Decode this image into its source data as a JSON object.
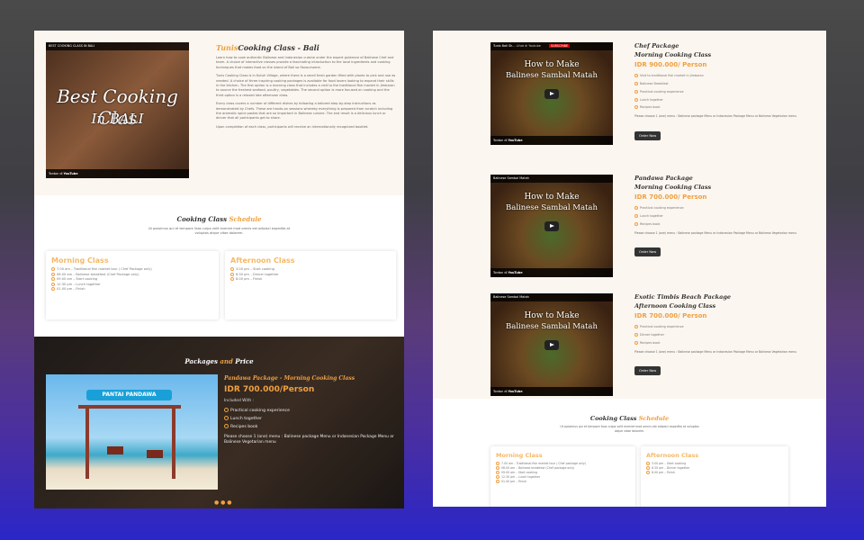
{
  "left": {
    "video": {
      "title": "BEST COOKING CLASS IN BALI",
      "overlay_line1": "Best Cooking Clas",
      "overlay_line2": "In BALI",
      "watch_on": "Tonton di",
      "yt": "YouTube"
    },
    "intro_title_prefix": "Tunis",
    "intro_title_rest": "Cooking Class - Bali",
    "intro_p1": "Learn how to cook authentic Balinese and Indonesian cuisine under the expert guidance of Balinese Chef and team. A choice of interactive classes provide a fascinating introduction to the local ingredients and cooking techniques that makes food on the island of Bali so flavoursome.",
    "intro_p2": "Tunis Cooking Class is in Kutuh Village, where there is a small fresh garden filled with plants to pick and use as needed. A choice of three inspiring cooking packages is available for food lovers looking to expand their skills in the kitchen. The first option is a morning class that includes a visit to the traditional fish market in Jimbaran to source the freshest seafood, poultry, vegetables. The second option is more focused on cooking and the third option is a relaxed late afternoon class.",
    "intro_p3": "Every class covers a number of different dishes by following a tailored step-by-step instructions as demonstrated by Chefs. These are hands-on sessions whereby everything is prepared from scratch including the aromatic spice pastes that are so important in Balinese cuisine. The end result is a delicious lunch or dinner that all participants get to share.",
    "intro_p4": "Upon completion of each class, participants will receive an internationally recognized booklet.",
    "schedule": {
      "title_a": "Cooking Class ",
      "title_b": "Schedule",
      "sub": "Ut possimus qui et tempore lisas culpa velit eveniet mod omnis est adipisci expedita at voluptas atque vitae dolorem.",
      "morning": {
        "title": "Morning Class",
        "items": [
          "7.00 am – Traditional fish market tour ( Chef Package only)",
          "08.00 am – Balinese breakfast (Chef Package only)",
          "09.00 am – Start cooking",
          "12.30 pm – Lunch together",
          "01.00 pm – Finish"
        ]
      },
      "afternoon": {
        "title": "Afternoon Class",
        "items": [
          "3.00 pm – Start cooking",
          "6.30 pm – Dinner together",
          "8.00 pm – Finish"
        ]
      }
    },
    "packages": {
      "title_a": "Packages ",
      "title_b": "and",
      "title_c": " Price",
      "image_sign": "PANTAI PANDAWA",
      "pkg_title": "Pandawa Package - Morning Cooking Class",
      "price": "IDR 700.000/Person",
      "included": "Included With :",
      "items": [
        "Practical cooking experience",
        "Lunch together",
        "Recipes book"
      ],
      "note": "Please choose 1 (one) menu : Balinese package Menu or Indonesian Package Menu or Balinese Vegetarian menu"
    }
  },
  "right": {
    "packages": [
      {
        "video_title": "Tunis Bali Sh...",
        "video_sub": "Lihat di Youtube",
        "subscribe": "SUBSCRIBE",
        "big1": "How to Make",
        "big2": "Balinese Sambal Matah",
        "name": "Chef Package",
        "session": "Morning Cooking Class",
        "price": "IDR 900.000/ Person",
        "items": [
          "Visit to traditional fish market in Jimbaran",
          "Balinese Breakfast",
          "Practical cooking experience",
          "Lunch together",
          "Recipes book"
        ],
        "note": "Please choose 1 (one) menu : Balinese package Menu or Indonesian Package Menu or Balinese Vegetarian menu",
        "button": "Order Now"
      },
      {
        "video_title": "Balinese Sambal Matah",
        "video_sub": "",
        "subscribe": "",
        "big1": "How to Make",
        "big2": "Balinese Sambal Matah",
        "name": "Pandawa Package",
        "session": "Morning Cooking Class",
        "price": "IDR 700.000/ Person",
        "items": [
          "Practical cooking experience",
          "Lunch together",
          "Recipes book"
        ],
        "note": "Please choose 1 (one) menu : Balinese package Menu or Indonesian Package Menu or Balinese Vegetarian menu",
        "button": "Order Now"
      },
      {
        "video_title": "Balinese Sambal Matah",
        "video_sub": "",
        "subscribe": "",
        "big1": "How to Make",
        "big2": "Balinese Sambal Matah",
        "name": "Exotic Timbis Beach Package",
        "session": "Afternoon Cooking Class",
        "price": "IDR 700.000/ Person",
        "items": [
          "Practical cooking experience",
          "Dinner together",
          "Recipes book"
        ],
        "note": "Please choose 1 (one) menu : Balinese package Menu or Indonesian Package Menu or Balinese Vegetarian menu",
        "button": "Order Now"
      }
    ],
    "schedule": {
      "title_a": "Cooking Class ",
      "title_b": "Schedule",
      "sub": "Ut possimus qui et tempore lisas culpa velit eveniet mod omnis est adipisci expedita at voluptas atque vitae dolorem.",
      "morning": {
        "title": "Morning Class",
        "items": [
          "7.00 am – Traditional fish market tour ( Chef package only)",
          "08.00 am – Balinese breakfast (Chef package only)",
          "09.00 am – Start cooking",
          "12.30 pm – Lunch together",
          "01.00 pm – Finish"
        ]
      },
      "afternoon": {
        "title": "Afternoon Class",
        "items": [
          "3.00 pm – Start cooking",
          "6.30 pm – Dinner together",
          "8.00 pm – Finish"
        ]
      }
    },
    "watch_on": "Tonton di",
    "yt": "YouTube"
  }
}
